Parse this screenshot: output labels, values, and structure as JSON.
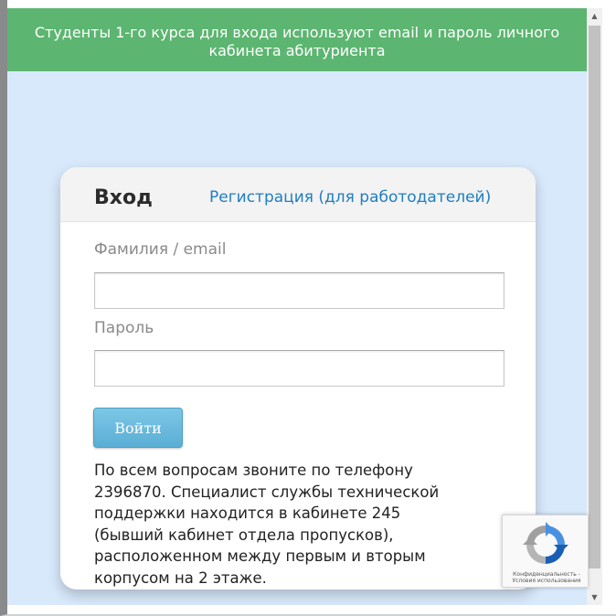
{
  "banner": {
    "lines": [
      "Студенты 1-го курса для входа используют email и пароль личного",
      "кабинета абитуриента"
    ]
  },
  "login_card": {
    "title": "Вход",
    "register_link": "Регистрация (для работодателей)",
    "username_label": "Фамилия / email",
    "username_value": "",
    "password_label": "Пароль",
    "password_value": "",
    "submit_label": "Войти",
    "info_lines": [
      "По всем вопросам звоните по телефону",
      "2396870. Специалист службы технической",
      "поддержки находится в кабинете 245",
      "(бывший кабинет отдела пропусков),",
      "расположенном между первым и вторым",
      "корпусом на 2 этаже."
    ]
  },
  "recaptcha": {
    "privacy": "Конфиденциальность -",
    "terms": "Условия использования",
    "icon": "recaptcha-logo"
  },
  "scrollbar": {
    "up_icon": "arrow-up",
    "down_icon": "arrow-down"
  },
  "colors": {
    "banner_bg": "#5cb570",
    "page_bg": "#d8e9fb",
    "link": "#1f7ec2",
    "button": "#6bbbe0"
  }
}
